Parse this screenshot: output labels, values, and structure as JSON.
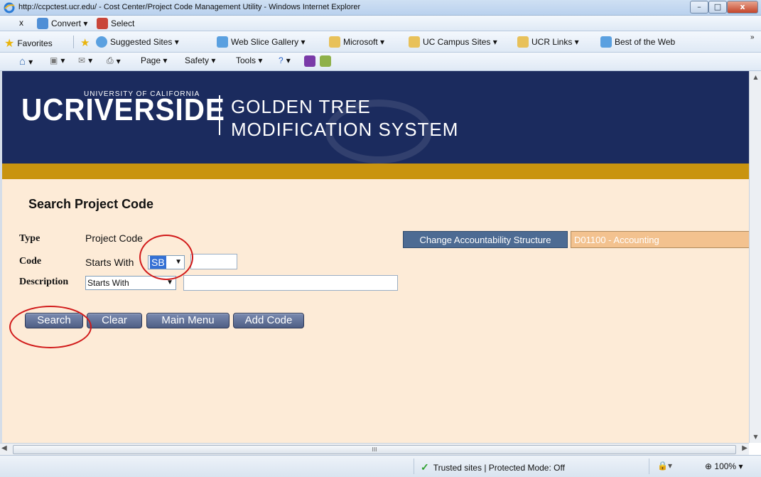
{
  "window": {
    "title": "http://ccpctest.ucr.edu/ - Cost Center/Project Code Management Utility - Windows Internet Explorer",
    "min": "–",
    "max": "□",
    "close": "x"
  },
  "command_bar": {
    "close": "x",
    "convert": "Convert ▾",
    "select": "Select"
  },
  "favorites_bar": {
    "favorites": "Favorites",
    "items": [
      "Suggested Sites ▾",
      "Web Slice Gallery ▾",
      "Microsoft ▾",
      "UC Campus Sites ▾",
      "UCR Links ▾",
      "Best of the Web"
    ],
    "overflow": "»"
  },
  "ie_toolbar": {
    "page": "Page ▾",
    "safety": "Safety ▾",
    "tools": "Tools ▾"
  },
  "banner": {
    "logo_main": "UCRIVERSIDE",
    "logo_small": "UNIVERSITY OF CALIFORNIA",
    "system_line1": "GOLDEN TREE",
    "system_line2": "MODIFICATION SYSTEM"
  },
  "page": {
    "title": "Search Project Code",
    "type_label": "Type",
    "type_value": "Project Code",
    "code_label": "Code",
    "code_match": "Starts With",
    "code_prefix_selected": "SB",
    "code_input_value": "",
    "description_label": "Description",
    "description_match_selected": "Starts With",
    "description_input_value": "",
    "change_button": "Change Accountability Structure",
    "accountability_value": "D01100 - Accounting"
  },
  "buttons": {
    "search": "Search",
    "clear": "Clear",
    "main_menu": "Main Menu",
    "add_code": "Add Code"
  },
  "status": {
    "zone": "Trusted sites | Protected Mode: Off",
    "zoom": "100%",
    "zoom_icon": "⊕",
    "arrow": "▾"
  },
  "scrollbar": {
    "grip": "III"
  },
  "colors": {
    "banner": "#1b2b5e",
    "gold": "#c9940f",
    "content_bg": "#fdebd7",
    "annotation": "#d11a1a"
  }
}
